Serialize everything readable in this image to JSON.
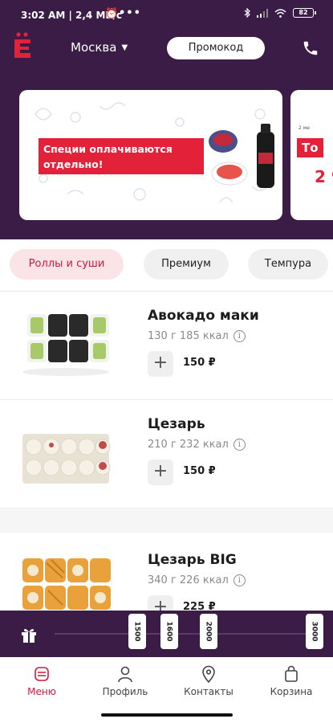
{
  "status_bar": {
    "time": "3:02 AM",
    "speed": "2,4 МБ/с",
    "dots": "•••",
    "battery": "82"
  },
  "header": {
    "city": "Москва",
    "promo_label": "Промокод"
  },
  "banners": [
    {
      "text": "Специи оплачиваются отдельно!"
    },
    {
      "small": "2 ме",
      "tag": "То",
      "price": "2 9"
    }
  ],
  "categories": [
    {
      "label": "Роллы и суши",
      "active": true
    },
    {
      "label": "Премиум",
      "active": false
    },
    {
      "label": "Темпура",
      "active": false
    }
  ],
  "products": [
    {
      "name": "Авокадо маки",
      "meta": "130 г 185 ккал",
      "price": "150 ₽"
    },
    {
      "name": "Цезарь",
      "meta": "210 г 232 ккал",
      "price": "150 ₽"
    },
    {
      "name": "Цезарь BIG",
      "meta": "340 г 226 ккал",
      "price": "225 ₽"
    }
  ],
  "bonus_milestones": [
    "1500",
    "1600",
    "2000",
    "3000"
  ],
  "nav": [
    {
      "label": "Меню",
      "icon": "menu-icon",
      "active": true
    },
    {
      "label": "Профиль",
      "icon": "profile-icon",
      "active": false
    },
    {
      "label": "Контакты",
      "icon": "location-icon",
      "active": false
    },
    {
      "label": "Корзина",
      "icon": "cart-icon",
      "active": false
    }
  ],
  "colors": {
    "brand_purple": "#3b1c46",
    "accent_red": "#e3223a",
    "active_chip_bg": "#fbe4e8"
  }
}
